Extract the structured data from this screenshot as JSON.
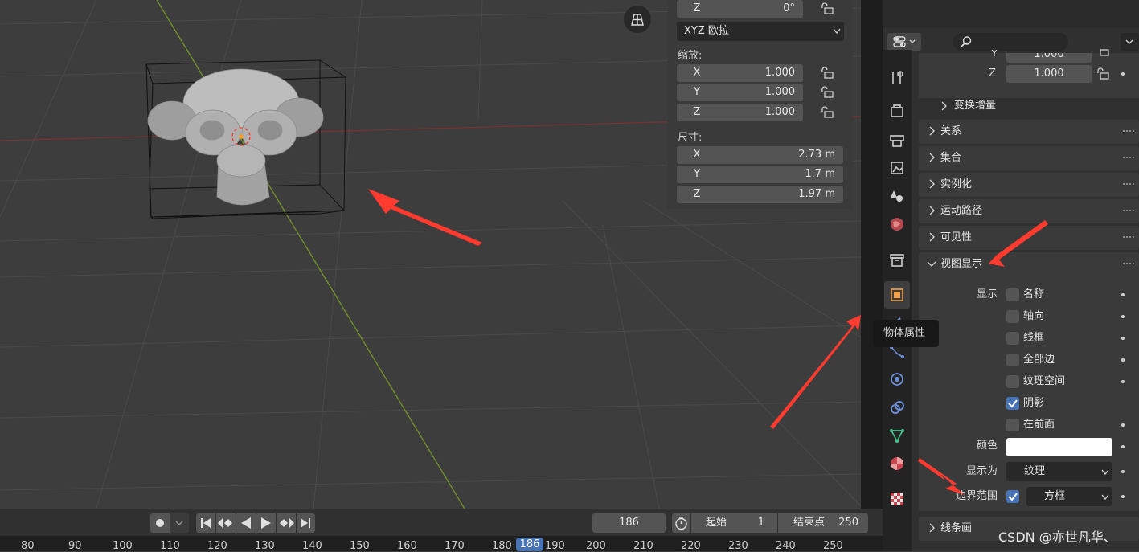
{
  "viewport": {
    "rotation_z": {
      "axis": "Z",
      "value": "0°"
    },
    "rotation_mode": "XYZ 欧拉",
    "scale_label": "缩放:",
    "scale": [
      {
        "axis": "X",
        "value": "1.000"
      },
      {
        "axis": "Y",
        "value": "1.000"
      },
      {
        "axis": "Z",
        "value": "1.000"
      }
    ],
    "dimensions_label": "尺寸:",
    "dimensions": [
      {
        "axis": "X",
        "value": "2.73 m"
      },
      {
        "axis": "Y",
        "value": "1.7 m"
      },
      {
        "axis": "Z",
        "value": "1.97 m"
      }
    ]
  },
  "properties": {
    "top_partial": {
      "axis": "Y",
      "value": "1.000"
    },
    "top_z": {
      "axis": "Z",
      "value": "1.000"
    },
    "delta_transform": "变换增量",
    "panels": [
      "关系",
      "集合",
      "实例化",
      "运动路径",
      "可见性"
    ],
    "viewport_display": "视图显示",
    "show_label": "显示",
    "checkboxes": [
      {
        "label": "名称",
        "checked": false
      },
      {
        "label": "轴向",
        "checked": false
      },
      {
        "label": "线框",
        "checked": false
      },
      {
        "label": "全部边",
        "checked": false
      },
      {
        "label": "纹理空间",
        "checked": false
      },
      {
        "label": "阴影",
        "checked": true
      },
      {
        "label": "在前面",
        "checked": false
      }
    ],
    "color_label": "颜色",
    "color_value": "#ffffff",
    "display_as_label": "显示为",
    "display_as_value": "纹理",
    "bounds_label": "边界范围",
    "bounds_checked": true,
    "bounds_value": "方框",
    "line_art": "线条画",
    "tooltip": "物体属性"
  },
  "timeline": {
    "current_frame": "186",
    "start_label": "起始",
    "start_value": "1",
    "end_label": "结束点",
    "end_value": "250",
    "ticks": [
      "80",
      "90",
      "100",
      "110",
      "120",
      "130",
      "140",
      "150",
      "160",
      "170",
      "180",
      "186",
      "190",
      "200",
      "210",
      "220",
      "230",
      "240",
      "250"
    ]
  },
  "watermark": "CSDN @亦世凡华、",
  "colors": {
    "accent": "#4772b3",
    "arrow": "#ff3b30",
    "x_axis": "#9b3636",
    "y_axis": "#6f8f2a"
  }
}
